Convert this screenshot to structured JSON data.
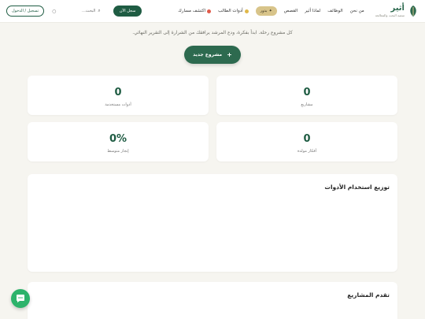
{
  "header": {
    "brand_name": "أثير",
    "brand_tagline": "منصة البحث والمعالجة",
    "nav": [
      "من نحن",
      "الوظائف",
      "لماذا أثير",
      "القصص"
    ],
    "gold_pill": "بذور",
    "student_tools": "أدوات الطالب",
    "discover_paths": "اكتشف مسارك",
    "register_now": "سجل الآن",
    "search_placeholder": "البحث...",
    "login": "تسجيل / الدخول",
    "accent": "#1f5c43"
  },
  "hero": {
    "subtitle": "كل مشروع رحلة. ابدأ بفكرة، ودع المرشد يرافقك من الشرارة إلى التقرير النهائي.",
    "new_project": "مشروع جديد"
  },
  "stats": [
    {
      "value": "0",
      "label": "مشاريع"
    },
    {
      "value": "0",
      "label": "أدوات مستخدمة"
    },
    {
      "value": "0",
      "label": "أفكار مولدة"
    },
    {
      "value": "0%",
      "label": "إنجاز متوسط"
    }
  ],
  "sections": {
    "tool_distribution": "توزيع استخدام الأدوات",
    "project_progress": "تقدم المشاريع"
  }
}
